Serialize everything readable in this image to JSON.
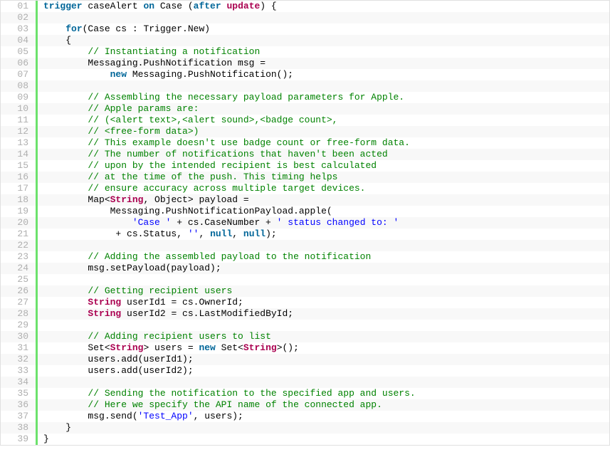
{
  "code": {
    "lines": [
      {
        "n": "01",
        "alt": false,
        "tokens": [
          {
            "c": "kw",
            "t": "trigger"
          },
          {
            "c": "",
            "t": " caseAlert "
          },
          {
            "c": "kw",
            "t": "on"
          },
          {
            "c": "",
            "t": " Case ("
          },
          {
            "c": "kw",
            "t": "after"
          },
          {
            "c": "",
            "t": " "
          },
          {
            "c": "typ",
            "t": "update"
          },
          {
            "c": "",
            "t": ") {"
          }
        ]
      },
      {
        "n": "02",
        "alt": true,
        "tokens": [
          {
            "c": "",
            "t": " "
          }
        ]
      },
      {
        "n": "03",
        "alt": false,
        "tokens": [
          {
            "c": "",
            "t": "    "
          },
          {
            "c": "kw",
            "t": "for"
          },
          {
            "c": "",
            "t": "(Case cs : Trigger.New)"
          }
        ]
      },
      {
        "n": "04",
        "alt": true,
        "tokens": [
          {
            "c": "",
            "t": "    {"
          }
        ]
      },
      {
        "n": "05",
        "alt": false,
        "tokens": [
          {
            "c": "",
            "t": "        "
          },
          {
            "c": "com",
            "t": "// Instantiating a notification"
          }
        ]
      },
      {
        "n": "06",
        "alt": true,
        "tokens": [
          {
            "c": "",
            "t": "        Messaging.PushNotification msg ="
          }
        ]
      },
      {
        "n": "07",
        "alt": false,
        "tokens": [
          {
            "c": "",
            "t": "            "
          },
          {
            "c": "kw",
            "t": "new"
          },
          {
            "c": "",
            "t": " Messaging.PushNotification();"
          }
        ]
      },
      {
        "n": "08",
        "alt": true,
        "tokens": [
          {
            "c": "",
            "t": " "
          }
        ]
      },
      {
        "n": "09",
        "alt": false,
        "tokens": [
          {
            "c": "",
            "t": "        "
          },
          {
            "c": "com",
            "t": "// Assembling the necessary payload parameters for Apple."
          }
        ]
      },
      {
        "n": "10",
        "alt": true,
        "tokens": [
          {
            "c": "",
            "t": "        "
          },
          {
            "c": "com",
            "t": "// Apple params are:"
          }
        ]
      },
      {
        "n": "11",
        "alt": false,
        "tokens": [
          {
            "c": "",
            "t": "        "
          },
          {
            "c": "com",
            "t": "// (<alert text>,<alert sound>,<badge count>,"
          }
        ]
      },
      {
        "n": "12",
        "alt": true,
        "tokens": [
          {
            "c": "",
            "t": "        "
          },
          {
            "c": "com",
            "t": "// <free-form data>)"
          }
        ]
      },
      {
        "n": "13",
        "alt": false,
        "tokens": [
          {
            "c": "",
            "t": "        "
          },
          {
            "c": "com",
            "t": "// This example doesn't use badge count or free-form data."
          }
        ]
      },
      {
        "n": "14",
        "alt": true,
        "tokens": [
          {
            "c": "",
            "t": "        "
          },
          {
            "c": "com",
            "t": "// The number of notifications that haven't been acted"
          }
        ]
      },
      {
        "n": "15",
        "alt": false,
        "tokens": [
          {
            "c": "",
            "t": "        "
          },
          {
            "c": "com",
            "t": "// upon by the intended recipient is best calculated"
          }
        ]
      },
      {
        "n": "16",
        "alt": true,
        "tokens": [
          {
            "c": "",
            "t": "        "
          },
          {
            "c": "com",
            "t": "// at the time of the push. This timing helps"
          }
        ]
      },
      {
        "n": "17",
        "alt": false,
        "tokens": [
          {
            "c": "",
            "t": "        "
          },
          {
            "c": "com",
            "t": "// ensure accuracy across multiple target devices."
          }
        ]
      },
      {
        "n": "18",
        "alt": true,
        "tokens": [
          {
            "c": "",
            "t": "        Map<"
          },
          {
            "c": "typ",
            "t": "String"
          },
          {
            "c": "",
            "t": ", Object> payload ="
          }
        ]
      },
      {
        "n": "19",
        "alt": false,
        "tokens": [
          {
            "c": "",
            "t": "            Messaging.PushNotificationPayload.apple("
          }
        ]
      },
      {
        "n": "20",
        "alt": true,
        "tokens": [
          {
            "c": "",
            "t": "                "
          },
          {
            "c": "str",
            "t": "'Case '"
          },
          {
            "c": "",
            "t": " + cs.CaseNumber + "
          },
          {
            "c": "str",
            "t": "' status changed to: '"
          }
        ]
      },
      {
        "n": "21",
        "alt": false,
        "tokens": [
          {
            "c": "",
            "t": "             + cs.Status, "
          },
          {
            "c": "str",
            "t": "''"
          },
          {
            "c": "",
            "t": ", "
          },
          {
            "c": "kw",
            "t": "null"
          },
          {
            "c": "",
            "t": ", "
          },
          {
            "c": "kw",
            "t": "null"
          },
          {
            "c": "",
            "t": ");"
          }
        ]
      },
      {
        "n": "22",
        "alt": true,
        "tokens": [
          {
            "c": "",
            "t": " "
          }
        ]
      },
      {
        "n": "23",
        "alt": false,
        "tokens": [
          {
            "c": "",
            "t": "        "
          },
          {
            "c": "com",
            "t": "// Adding the assembled payload to the notification"
          }
        ]
      },
      {
        "n": "24",
        "alt": true,
        "tokens": [
          {
            "c": "",
            "t": "        msg.setPayload(payload);"
          }
        ]
      },
      {
        "n": "25",
        "alt": false,
        "tokens": [
          {
            "c": "",
            "t": " "
          }
        ]
      },
      {
        "n": "26",
        "alt": true,
        "tokens": [
          {
            "c": "",
            "t": "        "
          },
          {
            "c": "com",
            "t": "// Getting recipient users"
          }
        ]
      },
      {
        "n": "27",
        "alt": false,
        "tokens": [
          {
            "c": "",
            "t": "        "
          },
          {
            "c": "typ",
            "t": "String"
          },
          {
            "c": "",
            "t": " userId1 = cs.OwnerId;"
          }
        ]
      },
      {
        "n": "28",
        "alt": true,
        "tokens": [
          {
            "c": "",
            "t": "        "
          },
          {
            "c": "typ",
            "t": "String"
          },
          {
            "c": "",
            "t": " userId2 = cs.LastModifiedById;"
          }
        ]
      },
      {
        "n": "29",
        "alt": false,
        "tokens": [
          {
            "c": "",
            "t": " "
          }
        ]
      },
      {
        "n": "30",
        "alt": true,
        "tokens": [
          {
            "c": "",
            "t": "        "
          },
          {
            "c": "com",
            "t": "// Adding recipient users to list"
          }
        ]
      },
      {
        "n": "31",
        "alt": false,
        "tokens": [
          {
            "c": "",
            "t": "        Set<"
          },
          {
            "c": "typ",
            "t": "String"
          },
          {
            "c": "",
            "t": "> users = "
          },
          {
            "c": "kw",
            "t": "new"
          },
          {
            "c": "",
            "t": " Set<"
          },
          {
            "c": "typ",
            "t": "String"
          },
          {
            "c": "",
            "t": ">();"
          }
        ]
      },
      {
        "n": "32",
        "alt": true,
        "tokens": [
          {
            "c": "",
            "t": "        users.add(userId1);"
          }
        ]
      },
      {
        "n": "33",
        "alt": false,
        "tokens": [
          {
            "c": "",
            "t": "        users.add(userId2);"
          }
        ]
      },
      {
        "n": "34",
        "alt": true,
        "tokens": [
          {
            "c": "",
            "t": " "
          }
        ]
      },
      {
        "n": "35",
        "alt": false,
        "tokens": [
          {
            "c": "",
            "t": "        "
          },
          {
            "c": "com",
            "t": "// Sending the notification to the specified app and users."
          }
        ]
      },
      {
        "n": "36",
        "alt": true,
        "tokens": [
          {
            "c": "",
            "t": "        "
          },
          {
            "c": "com",
            "t": "// Here we specify the API name of the connected app."
          }
        ]
      },
      {
        "n": "37",
        "alt": false,
        "tokens": [
          {
            "c": "",
            "t": "        msg.send("
          },
          {
            "c": "str",
            "t": "'Test_App'"
          },
          {
            "c": "",
            "t": ", users);"
          }
        ]
      },
      {
        "n": "38",
        "alt": true,
        "tokens": [
          {
            "c": "",
            "t": "    }"
          }
        ]
      },
      {
        "n": "39",
        "alt": false,
        "tokens": [
          {
            "c": "",
            "t": "}"
          }
        ]
      }
    ]
  }
}
